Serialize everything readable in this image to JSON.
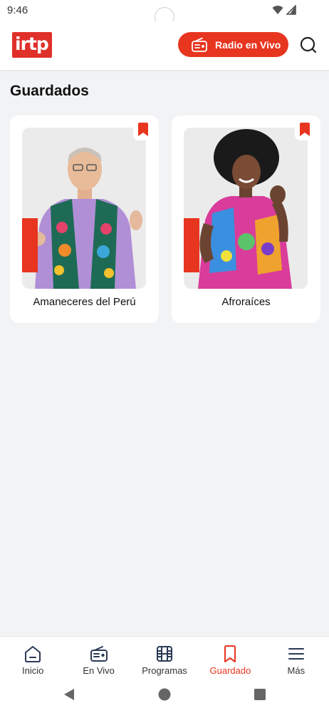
{
  "status_bar": {
    "time": "9:46"
  },
  "header": {
    "logo_text": "irtp",
    "radio_button_label": "Radio en Vivo",
    "accent_color": "#e8351f"
  },
  "page": {
    "title": "Guardados"
  },
  "saved_items": [
    {
      "title": "Amaneceres del Perú"
    },
    {
      "title": "Afroraíces"
    }
  ],
  "bottom_nav": [
    {
      "label": "Inicio",
      "icon": "home-icon"
    },
    {
      "label": "En Vivo",
      "icon": "radio-icon"
    },
    {
      "label": "Programas",
      "icon": "film-icon"
    },
    {
      "label": "Guardado",
      "icon": "bookmark-icon",
      "active": true
    },
    {
      "label": "Más",
      "icon": "menu-icon"
    }
  ]
}
